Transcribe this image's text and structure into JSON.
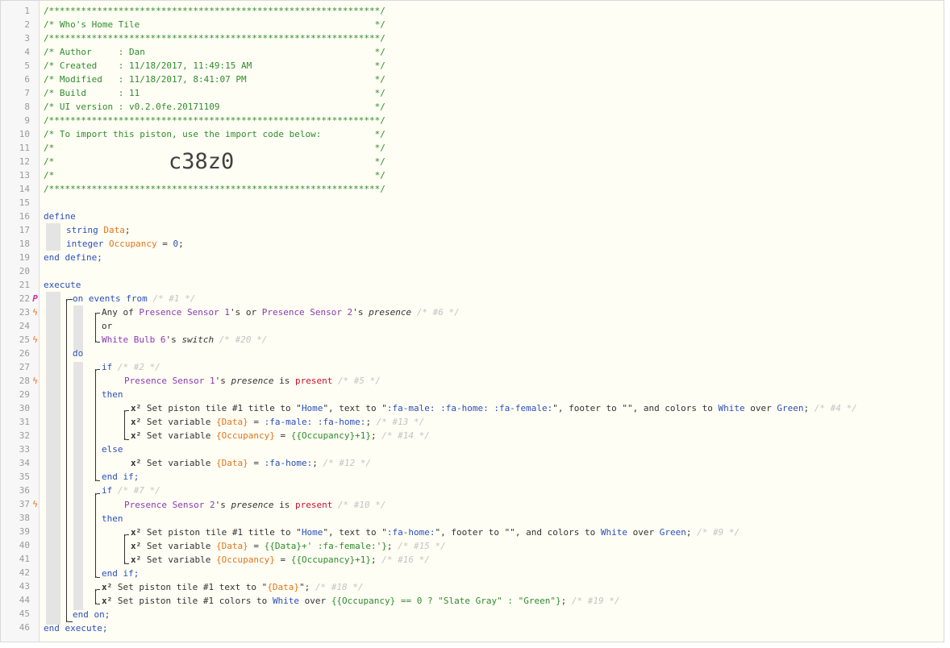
{
  "header_lines": [
    "/**************************************************************/",
    "/* Who's Home Tile                                            */",
    "/**************************************************************/",
    "/* Author     : Dan                                           */",
    "/* Created    : 11/18/2017, 11:49:15 AM                       */",
    "/* Modified   : 11/18/2017, 8:41:07 PM                        */",
    "/* Build      : 11                                            */",
    "/* UI version : v0.2.0fe.20171109                             */",
    "/**************************************************************/",
    "/* To import this piston, use the import code below:          */",
    "/*                                                            */",
    "/*                                                            */",
    "/*                                                            */",
    "/**************************************************************/"
  ],
  "import_code": "c38z0",
  "line_numbers": [
    "1",
    "2",
    "3",
    "4",
    "5",
    "6",
    "7",
    "8",
    "9",
    "10",
    "11",
    "12",
    "13",
    "14",
    "15",
    "16",
    "17",
    "18",
    "19",
    "20",
    "21",
    "22",
    "23",
    "24",
    "25",
    "26",
    "27",
    "28",
    "29",
    "30",
    "31",
    "32",
    "33",
    "34",
    "35",
    "36",
    "37",
    "38",
    "39",
    "40",
    "41",
    "42",
    "43",
    "44",
    "45",
    "46"
  ],
  "markers": {
    "trigger": "P",
    "bolt": "ϟ"
  },
  "colors": {
    "background": "#fffef4",
    "comment": "#2d8c2d",
    "keyword": "#2a4ebd",
    "device": "#8a3bb3",
    "variable": "#e0761a",
    "muted": "#c3c3c3",
    "state": "#c8102e",
    "bolt": "#ff6a1f"
  },
  "code": {
    "define": "define",
    "string": "string",
    "data_var": "Data",
    "integer": "integer",
    "occupancy_var": "Occupancy",
    "zero": "0",
    "end_define": "end define;",
    "execute": "execute",
    "on_events_from": "on events from",
    "c1": "/* #1 */",
    "any_of": "Any of ",
    "ps1": "Presence Sensor 1",
    "s_or": "'s or ",
    "ps2": "Presence Sensor 2",
    "s_poss": "'s ",
    "presence": "presence",
    "c6": "/* #6 */",
    "or": "or",
    "wb6": "White Bulb 6",
    "switch_word": "switch",
    "c20": "/* #20 */",
    "do": "do",
    "if": "if",
    "c2": "/* #2 */",
    "is": " is ",
    "present": "present",
    "c5": "/* #5 */",
    "then": "then",
    "x2": "x²",
    "set_tile_title": " Set piston tile #1 title to \"",
    "home": "Home",
    "text_to": "\", text to \"",
    "fa_male_home_female": ":fa-male: :fa-home: :fa-female:",
    "footer_colors": "\", footer to \"\", and colors to ",
    "white": "White",
    "over": " over ",
    "green": "Green",
    "semi": ";",
    "c4": "/* #4 */",
    "set_variable": " Set variable ",
    "data_braced": "{Data}",
    "eq": " = ",
    "fa_male_home": ":fa-male: :fa-home:",
    "c13": "/* #13 */",
    "occ_braced": "{Occupancy}",
    "occ_plus": "{{Occupancy}+1}",
    "c14": "/* #14 */",
    "else": "else",
    "fa_home": ":fa-home:",
    "c12": "/* #12 */",
    "end_if": "end if;",
    "c7": "/* #7 */",
    "c10": "/* #10 */",
    "c9": "/* #9 */",
    "data_plus_female": "{{Data}+' :fa-female:'}",
    "c15": "/* #15 */",
    "c16": "/* #16 */",
    "set_tile_text": " Set piston tile #1 text to \"",
    "quote_semi": "\";",
    "c18": "/* #18 */",
    "set_tile_colors": " Set piston tile #1 colors to ",
    "occ_expr": "{{Occupancy} == 0 ? \"Slate Gray\" : \"Green\"}",
    "c19": "/* #19 */",
    "end_on": "end on;",
    "end_execute": "end execute;"
  }
}
